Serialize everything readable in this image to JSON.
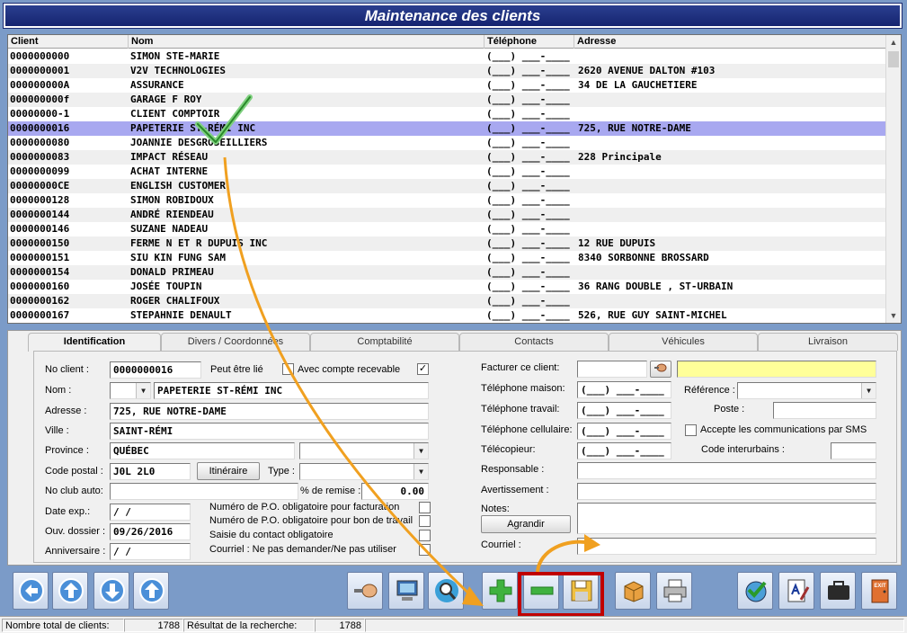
{
  "window": {
    "title": "Maintenance des clients"
  },
  "grid": {
    "headers": [
      "Client",
      "Nom",
      "Téléphone",
      "Adresse"
    ],
    "rows": [
      {
        "client": "0000000000",
        "nom": "SIMON STE-MARIE",
        "tel": "(___) ___-____",
        "adresse": ""
      },
      {
        "client": "0000000001",
        "nom": "V2V TECHNOLOGIES",
        "tel": "(___) ___-____",
        "adresse": "2620 AVENUE DALTON #103"
      },
      {
        "client": "000000000A",
        "nom": "ASSURANCE",
        "tel": "(___) ___-____",
        "adresse": "34 DE LA GAUCHETIERE"
      },
      {
        "client": "000000000f",
        "nom": "GARAGE F ROY",
        "tel": "(___) ___-____",
        "adresse": ""
      },
      {
        "client": "00000000-1",
        "nom": "CLIENT COMPTOIR",
        "tel": "(___) ___-____",
        "adresse": ""
      },
      {
        "client": "0000000016",
        "nom": "PAPETERIE ST-RÉMI INC",
        "tel": "(___) ___-____",
        "adresse": "725, RUE NOTRE-DAME",
        "selected": true
      },
      {
        "client": "0000000080",
        "nom": "JOANNIE DESGROSEILLIERS",
        "tel": "(___) ___-____",
        "adresse": ""
      },
      {
        "client": "0000000083",
        "nom": "IMPACT RÉSEAU",
        "tel": "(___) ___-____",
        "adresse": "228 Principale"
      },
      {
        "client": "0000000099",
        "nom": "ACHAT INTERNE",
        "tel": "(___) ___-____",
        "adresse": ""
      },
      {
        "client": "00000000CE",
        "nom": "ENGLISH CUSTOMER",
        "tel": "(___) ___-____",
        "adresse": ""
      },
      {
        "client": "0000000128",
        "nom": "SIMON ROBIDOUX",
        "tel": "(___) ___-____",
        "adresse": ""
      },
      {
        "client": "0000000144",
        "nom": "ANDRÉ RIENDEAU",
        "tel": "(___) ___-____",
        "adresse": ""
      },
      {
        "client": "0000000146",
        "nom": "SUZANE NADEAU",
        "tel": "(___) ___-____",
        "adresse": ""
      },
      {
        "client": "0000000150",
        "nom": "FERME N ET R DUPUIS INC",
        "tel": "(___) ___-____",
        "adresse": "12 RUE DUPUIS"
      },
      {
        "client": "0000000151",
        "nom": "SIU KIN FUNG SAM",
        "tel": "(___) ___-____",
        "adresse": "8340 SORBONNE BROSSARD"
      },
      {
        "client": "0000000154",
        "nom": "DONALD PRIMEAU",
        "tel": "(___) ___-____",
        "adresse": ""
      },
      {
        "client": "0000000160",
        "nom": "JOSÉE TOUPIN",
        "tel": "(___) ___-____",
        "adresse": "36 RANG DOUBLE , ST-URBAIN"
      },
      {
        "client": "0000000162",
        "nom": "ROGER CHALIFOUX",
        "tel": "(___) ___-____",
        "adresse": ""
      },
      {
        "client": "0000000167",
        "nom": "STEPAHNIE DENAULT",
        "tel": "(___) ___-____",
        "adresse": "526, RUE GUY SAINT-MICHEL"
      }
    ]
  },
  "tabs": [
    "Identification",
    "Divers / Coordonnées",
    "Comptabilité",
    "Contacts",
    "Véhicules",
    "Livraison"
  ],
  "form": {
    "no_client_label": "No client :",
    "no_client": "0000000016",
    "peut_etre_lie": "Peut être lié",
    "avec_compte": "Avec compte recevable",
    "avec_compte_checked": "✓",
    "nom_label": "Nom :",
    "nom": "PAPETERIE ST-RÉMI INC",
    "adresse_label": "Adresse :",
    "adresse": "725, RUE NOTRE-DAME",
    "ville_label": "Ville :",
    "ville": "SAINT-RÉMI",
    "province_label": "Province :",
    "province": "QUÉBEC",
    "code_postal_label": "Code postal :",
    "code_postal": "J0L 2L0",
    "itineraire": "Itinéraire",
    "type_label": "Type :",
    "no_club_label": "No club auto:",
    "remise_label": "% de remise :",
    "remise": "0.00",
    "date_exp_label": "Date exp.:",
    "date_exp": " / /",
    "ouv_dossier_label": "Ouv. dossier :",
    "ouv_dossier": "09/26/2016",
    "anniversaire_label": "Anniversaire :",
    "anniversaire": " / /",
    "po_facturation": "Numéro de P.O. obligatoire pour facturation",
    "po_bon_travail": "Numéro de P.O. obligatoire pour bon de travail",
    "saisie_contact": "Saisie du contact obligatoire",
    "courriel_ne_pas": "Courriel : Ne pas demander/Ne pas utiliser",
    "facturer_label": "Facturer ce client:",
    "tel_maison_label": "Téléphone maison:",
    "tel_maison": "(___) ___-____",
    "tel_travail_label": "Téléphone travail:",
    "tel_travail": "(___) ___-____",
    "tel_cell_label": "Téléphone cellulaire:",
    "tel_cell": "(___) ___-____",
    "telecopieur_label": "Télécopieur:",
    "telecopieur": "(___) ___-____",
    "reference_label": "Référence :",
    "poste_label": "Poste :",
    "sms_label": "Accepte les communications par SMS",
    "code_interurbains_label": "Code interurbains :",
    "responsable_label": "Responsable :",
    "avertissement_label": "Avertissement :",
    "notes_label": "Notes:",
    "agrandir": "Agrandir",
    "courriel_label": "Courriel :"
  },
  "toolbar": {
    "icons": [
      "nav-first-icon",
      "nav-previous-icon",
      "nav-next-icon",
      "nav-last-icon",
      "search-client-icon",
      "computer-icon",
      "find-icon",
      "add-icon",
      "delete-icon",
      "save-icon",
      "package-icon",
      "print-icon",
      "globe-check-icon",
      "document-edit-icon",
      "briefcase-icon",
      "exit-icon"
    ]
  },
  "exit_label": "EXIT",
  "status": {
    "total_label": "Nombre total de clients:",
    "total": "1788",
    "result_label": "Résultat de la recherche:",
    "result": "1788"
  },
  "colors": {
    "title_bg": "#1f2f85",
    "selected_row": "#a8a8f0",
    "highlight_box": "#c00000",
    "annotation_arrow": "#f0a020",
    "facturer_field": "#ffff99"
  }
}
